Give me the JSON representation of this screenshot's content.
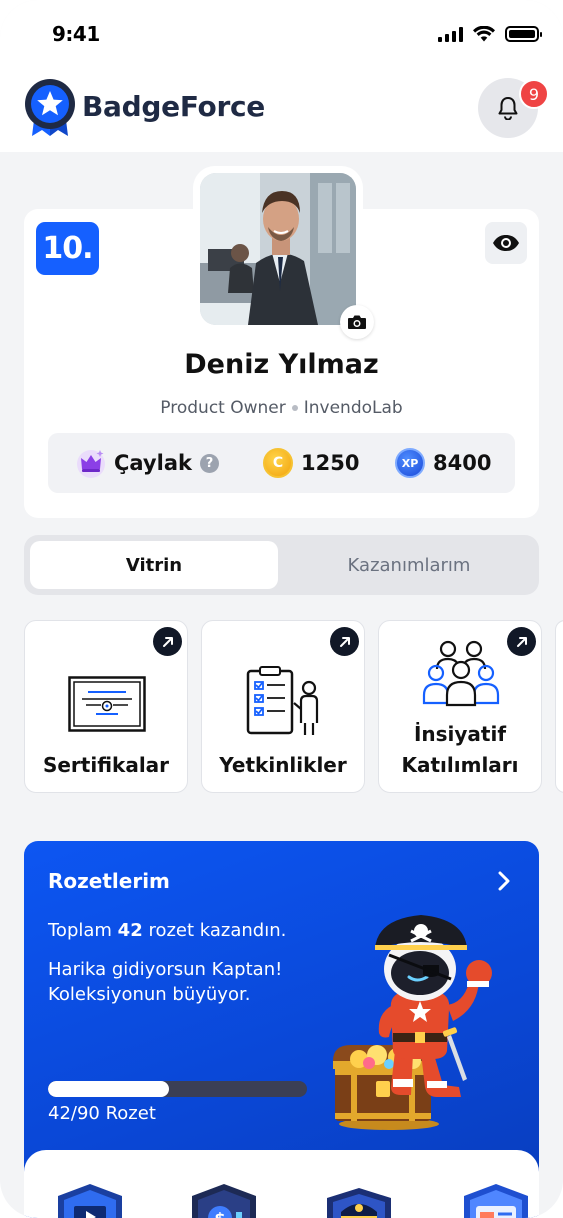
{
  "status_bar": {
    "time": "9:41"
  },
  "header": {
    "brand": "BadgeForce",
    "notification_count": "9"
  },
  "profile": {
    "rank": "10.",
    "name": "Deniz Yılmaz",
    "role": "Product Owner",
    "company": "InvendoLab",
    "level": "Çaylak",
    "level_help": "?",
    "coin_symbol": "C",
    "coins": "1250",
    "xp_symbol": "XP",
    "xp": "8400"
  },
  "tabs": [
    {
      "label": "Vitrin",
      "active": true
    },
    {
      "label": "Kazanımlarım",
      "active": false
    }
  ],
  "showcase": [
    {
      "label": "Sertifikalar",
      "icon": "certificate-icon"
    },
    {
      "label": "Yetkinlikler",
      "icon": "clipboard-checklist-icon"
    },
    {
      "label_line1": "İnsiyatif",
      "label_line2": "Katılımları",
      "icon": "team-icon"
    }
  ],
  "badges_panel": {
    "title": "Rozetlerim",
    "total_prefix": "Toplam ",
    "total": "42",
    "total_suffix": " rozet kazandın.",
    "message": "Harika gidiyorsun Kaptan! Koleksiyonun büyüyor.",
    "progress_text": "42/90 Rozet",
    "earned": 42,
    "goal": 90
  },
  "colors": {
    "accent": "#1560ff",
    "brand_text": "#1f2a44",
    "notification": "#ef4444",
    "panel_blue": "#0a47d6"
  }
}
